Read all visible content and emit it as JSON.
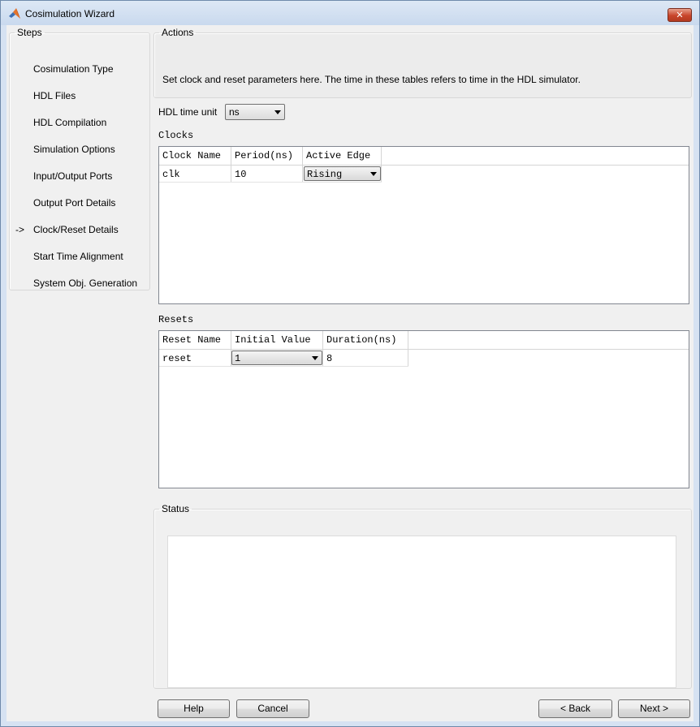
{
  "window": {
    "title": "Cosimulation Wizard",
    "close_glyph": "✕"
  },
  "steps": {
    "legend": "Steps",
    "current_marker": "->",
    "items": [
      {
        "label": "Cosimulation Type"
      },
      {
        "label": "HDL Files"
      },
      {
        "label": "HDL Compilation"
      },
      {
        "label": "Simulation Options"
      },
      {
        "label": "Input/Output Ports"
      },
      {
        "label": "Output Port Details"
      },
      {
        "label": "Clock/Reset Details",
        "current": true
      },
      {
        "label": "Start Time Alignment"
      },
      {
        "label": "System Obj. Generation"
      }
    ]
  },
  "actions": {
    "legend": "Actions",
    "text": "Set clock and reset parameters here. The time in these tables refers to time in the HDL simulator."
  },
  "time_unit": {
    "label": "HDL time unit",
    "value": "ns"
  },
  "clocks": {
    "title": "Clocks",
    "columns": [
      "Clock Name",
      "Period(ns)",
      "Active Edge"
    ],
    "rows": [
      {
        "name": "clk",
        "period": "10",
        "edge": "Rising"
      }
    ]
  },
  "resets": {
    "title": "Resets",
    "columns": [
      "Reset Name",
      "Initial Value",
      "Duration(ns)"
    ],
    "rows": [
      {
        "name": "reset",
        "initial": "1",
        "duration": "8"
      }
    ]
  },
  "status": {
    "legend": "Status",
    "text": ""
  },
  "buttons": {
    "help": "Help",
    "cancel": "Cancel",
    "back": "< Back",
    "next": "Next >"
  },
  "colors": {
    "titlebar": "#c9d9ee",
    "close_button": "#c8452b",
    "dialog_bg": "#f0f0f0"
  },
  "icons": {
    "app": "matlab-logo-icon",
    "close": "close-icon",
    "dropdown": "chevron-down-icon"
  }
}
